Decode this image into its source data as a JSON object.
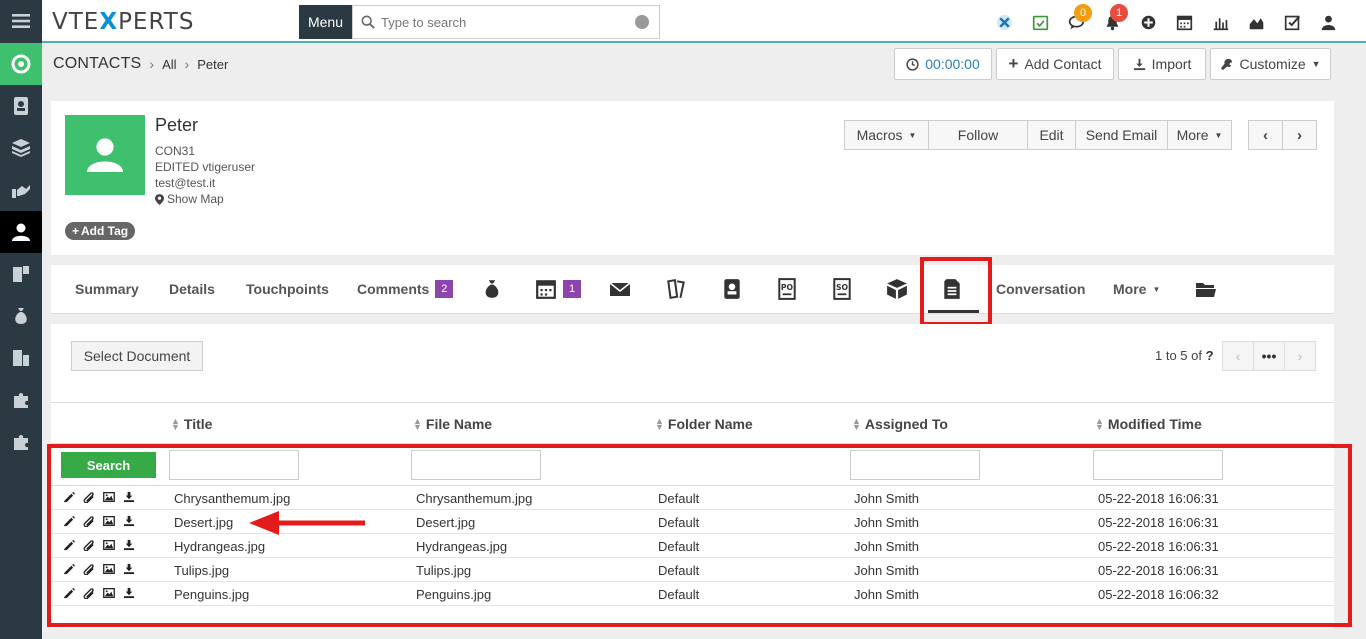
{
  "topbar": {
    "logo_pre": "VTE",
    "logo_x": "X",
    "logo_post": "PERTS",
    "menu_label": "Menu",
    "search_placeholder": "Type to search",
    "comments_badge": "0",
    "notifications_badge": "1"
  },
  "breadcrumb": {
    "module": "CONTACTS",
    "filter": "All",
    "record": "Peter"
  },
  "header_buttons": {
    "timer": "00:00:00",
    "add_contact": "Add Contact",
    "import": "Import",
    "customize": "Customize"
  },
  "record": {
    "name": "Peter",
    "id": "CON31",
    "edited": "EDITED vtigeruser",
    "email": "test@test.it",
    "map": "Show Map",
    "add_tag": "Add Tag"
  },
  "actions": {
    "macros": "Macros",
    "follow": "Follow",
    "edit": "Edit",
    "send_email": "Send Email",
    "more": "More"
  },
  "tabs": {
    "summary": "Summary",
    "details": "Details",
    "touchpoints": "Touchpoints",
    "comments": "Comments",
    "comments_count": "2",
    "calendar_count": "1",
    "conversation": "Conversation",
    "more": "More"
  },
  "documents": {
    "select_document": "Select Document",
    "pager_range": "1 to 5",
    "pager_of": "of",
    "pager_total": "?",
    "search_label": "Search",
    "columns": [
      "Title",
      "File Name",
      "Folder Name",
      "Assigned To",
      "Modified Time"
    ],
    "rows": [
      {
        "title": "Chrysanthemum.jpg",
        "file": "Chrysanthemum.jpg",
        "folder": "Default",
        "assigned": "John Smith",
        "modified": "05-22-2018 16:06:31"
      },
      {
        "title": "Desert.jpg",
        "file": "Desert.jpg",
        "folder": "Default",
        "assigned": "John Smith",
        "modified": "05-22-2018 16:06:31"
      },
      {
        "title": "Hydrangeas.jpg",
        "file": "Hydrangeas.jpg",
        "folder": "Default",
        "assigned": "John Smith",
        "modified": "05-22-2018 16:06:31"
      },
      {
        "title": "Tulips.jpg",
        "file": "Tulips.jpg",
        "folder": "Default",
        "assigned": "John Smith",
        "modified": "05-22-2018 16:06:31"
      },
      {
        "title": "Penguins.jpg",
        "file": "Penguins.jpg",
        "folder": "Default",
        "assigned": "John Smith",
        "modified": "05-22-2018 16:06:32"
      }
    ]
  },
  "colors": {
    "sidebar": "#2b3a42",
    "avatar": "#3ec06f",
    "search_button": "#35aa47",
    "highlight": "#e31b1b",
    "badge_purple": "#8e44ad"
  }
}
